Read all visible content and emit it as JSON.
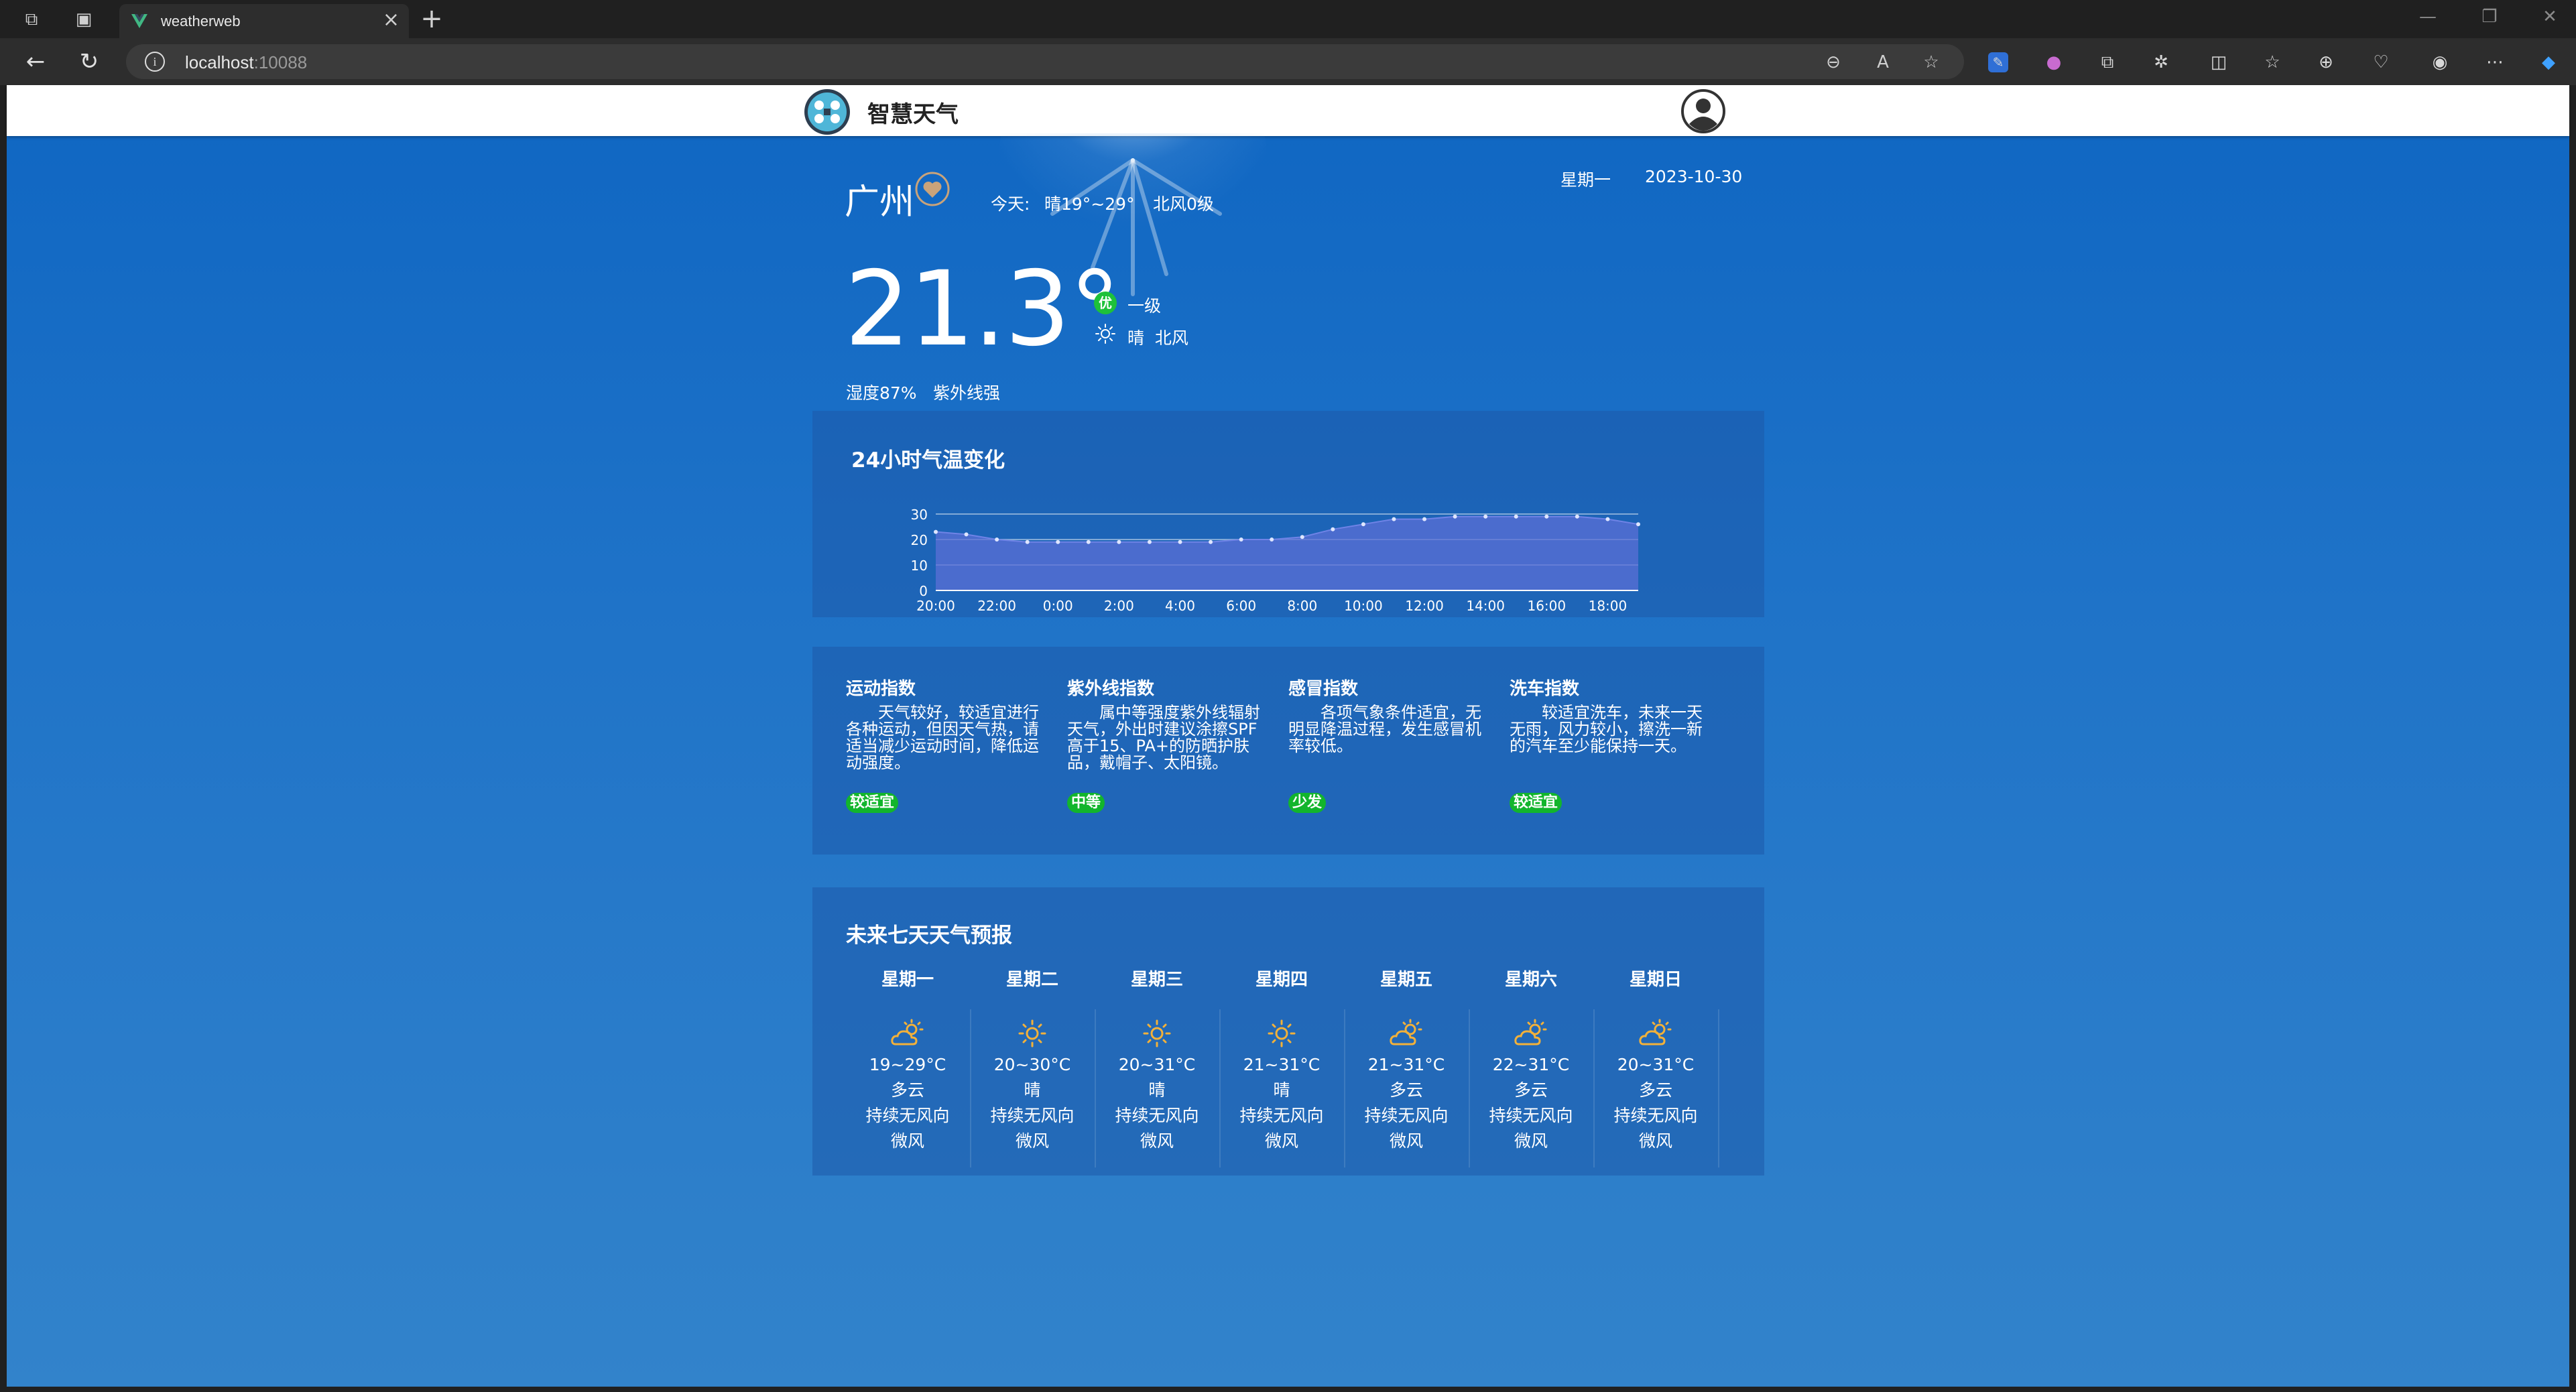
{
  "browser": {
    "tab_title": "weatherweb",
    "url_host": "localhost",
    "url_port": ":10088"
  },
  "header": {
    "brand": "智慧天气"
  },
  "current": {
    "city": "广州",
    "today_label": "今天:",
    "today_range": "晴19°~29°",
    "today_wind": "北风0级",
    "weekday": "星期一",
    "date": "2023-10-30",
    "temperature": "21.3°",
    "aqi_badge": "优",
    "aqi_level": "一级",
    "condition": "晴  北风",
    "humidity": "湿度87%",
    "uv": "紫外线强"
  },
  "chart": {
    "title": "24小时气温变化"
  },
  "chart_data": {
    "type": "area",
    "title": "24小时气温变化",
    "x": [
      "20:00",
      "21:00",
      "22:00",
      "23:00",
      "0:00",
      "1:00",
      "2:00",
      "3:00",
      "4:00",
      "5:00",
      "6:00",
      "7:00",
      "8:00",
      "9:00",
      "10:00",
      "11:00",
      "12:00",
      "13:00",
      "14:00",
      "15:00",
      "16:00",
      "17:00",
      "18:00",
      "19:00"
    ],
    "x_tick_labels": [
      "20:00",
      "22:00",
      "0:00",
      "2:00",
      "4:00",
      "6:00",
      "8:00",
      "10:00",
      "12:00",
      "14:00",
      "16:00",
      "18:00"
    ],
    "values": [
      23,
      22,
      20,
      19,
      19,
      19,
      19,
      19,
      19,
      19,
      20,
      20,
      21,
      24,
      26,
      28,
      28,
      29,
      29,
      29,
      29,
      29,
      28,
      26
    ],
    "ylim": [
      0,
      30
    ],
    "y_ticks": [
      0,
      10,
      20,
      30
    ],
    "grid": true,
    "color": "#5b6fd6"
  },
  "indices": [
    {
      "title": "运动指数",
      "desc": "天气较好，较适宜进行各种运动，但因天气热，请适当减少运动时间，降低运动强度。",
      "badge": "较适宜"
    },
    {
      "title": "紫外线指数",
      "desc": "属中等强度紫外线辐射天气，外出时建议涂擦SPF高于15、PA+的防晒护肤品，戴帽子、太阳镜。",
      "badge": "中等"
    },
    {
      "title": "感冒指数",
      "desc": "各项气象条件适宜，无明显降温过程，发生感冒机率较低。",
      "badge": "少发"
    },
    {
      "title": "洗车指数",
      "desc": "较适宜洗车，未来一天无雨，风力较小，擦洗一新的汽车至少能保持一天。",
      "badge": "较适宜"
    }
  ],
  "week": {
    "title": "未来七天天气预报",
    "days": [
      {
        "name": "星期一",
        "icon": "partly-cloudy-icon",
        "temp": "19~29°C",
        "weather": "多云",
        "wind": "持续无风向",
        "power": "微风"
      },
      {
        "name": "星期二",
        "icon": "sun-icon",
        "temp": "20~30°C",
        "weather": "晴",
        "wind": "持续无风向",
        "power": "微风"
      },
      {
        "name": "星期三",
        "icon": "sun-icon",
        "temp": "20~31°C",
        "weather": "晴",
        "wind": "持续无风向",
        "power": "微风"
      },
      {
        "name": "星期四",
        "icon": "sun-icon",
        "temp": "21~31°C",
        "weather": "晴",
        "wind": "持续无风向",
        "power": "微风"
      },
      {
        "name": "星期五",
        "icon": "partly-cloudy-icon",
        "temp": "21~31°C",
        "weather": "多云",
        "wind": "持续无风向",
        "power": "微风"
      },
      {
        "name": "星期六",
        "icon": "partly-cloudy-icon",
        "temp": "22~31°C",
        "weather": "多云",
        "wind": "持续无风向",
        "power": "微风"
      },
      {
        "name": "星期日",
        "icon": "partly-cloudy-icon",
        "temp": "20~31°C",
        "weather": "多云",
        "wind": "持续无风向",
        "power": "微风"
      }
    ]
  },
  "colors": {
    "accent_green": "#12b52c",
    "icon_orange": "#f2b13a"
  }
}
